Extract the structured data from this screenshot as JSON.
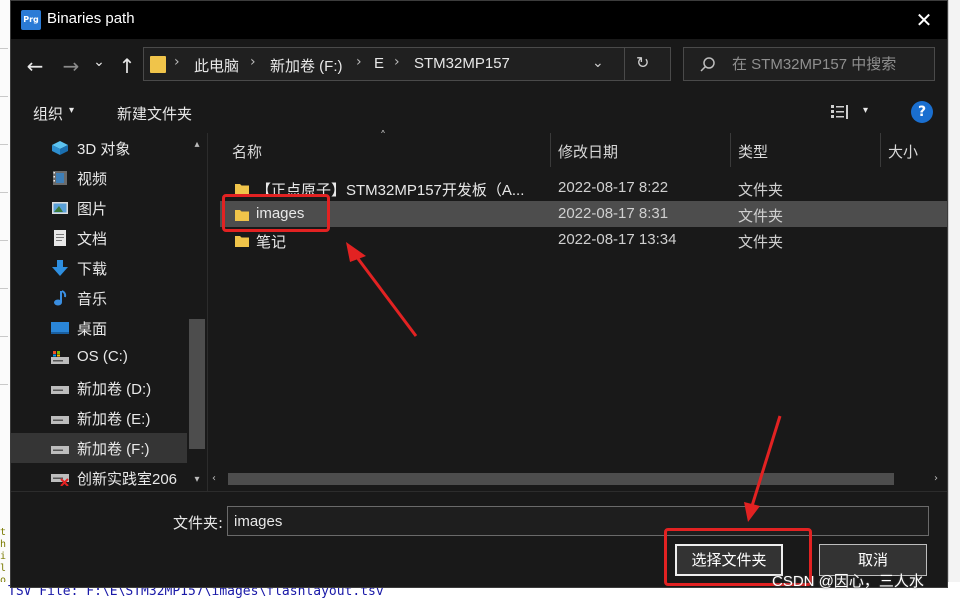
{
  "window": {
    "title": "Binaries path",
    "app_icon_text": "Prg",
    "close_glyph": "✕"
  },
  "nav": {
    "back_glyph": "←",
    "forward_glyph": "→",
    "recent_glyph": "⌄",
    "up_glyph": "↑",
    "breadcrumbs": [
      "此电脑",
      "新加卷 (F:)",
      "E",
      "STM32MP157"
    ],
    "separator": "›",
    "dropdown_glyph": "⌄",
    "refresh_glyph": "↻"
  },
  "search": {
    "placeholder": "在 STM32MP157 中搜索"
  },
  "toolbar": {
    "organize_label": "组织",
    "dropdown_glyph": "▾",
    "new_folder_label": "新建文件夹",
    "help_glyph": "?"
  },
  "sidebar": {
    "items": [
      {
        "label": "3D 对象",
        "icon": "3d-objects-icon"
      },
      {
        "label": "视频",
        "icon": "video-icon"
      },
      {
        "label": "图片",
        "icon": "pictures-icon"
      },
      {
        "label": "文档",
        "icon": "documents-icon"
      },
      {
        "label": "下载",
        "icon": "download-icon"
      },
      {
        "label": "音乐",
        "icon": "music-icon"
      },
      {
        "label": "桌面",
        "icon": "desktop-icon"
      },
      {
        "label": "OS (C:)",
        "icon": "drive-icon"
      },
      {
        "label": "新加卷 (D:)",
        "icon": "drive-icon"
      },
      {
        "label": "新加卷 (E:)",
        "icon": "drive-icon"
      },
      {
        "label": "新加卷 (F:)",
        "icon": "drive-icon"
      },
      {
        "label": "创新实践室206",
        "icon": "network-drive-icon"
      }
    ],
    "selected_index": 10,
    "scroll_up_glyph": "▴",
    "scroll_down_glyph": "▾"
  },
  "columns": {
    "name": "名称",
    "date": "修改日期",
    "type": "类型",
    "size": "大小",
    "sort_glyph": "˄"
  },
  "files": [
    {
      "name": "【正点原子】STM32MP157开发板（A...",
      "date": "2022-08-17 8:22",
      "type": "文件夹"
    },
    {
      "name": "images",
      "date": "2022-08-17 8:31",
      "type": "文件夹"
    },
    {
      "name": "笔记",
      "date": "2022-08-17 13:34",
      "type": "文件夹"
    }
  ],
  "selected_file_index": 1,
  "hscroll": {
    "left_glyph": "‹",
    "right_glyph": "›"
  },
  "footer": {
    "folder_label": "文件夹:",
    "folder_value": "images",
    "select_button": "选择文件夹",
    "cancel_button": "取消"
  },
  "background": {
    "bottom_text": "TSV File: F:\\E\\STM32MP157\\images\\flashlayout.tsv",
    "left_chars": [
      "t",
      "h",
      "i",
      "l",
      "o"
    ]
  },
  "watermark": "CSDN @因心，三人水",
  "colors": {
    "dialog_bg": "#191919",
    "titlebar_bg": "#000000",
    "selection": "#4d4d4d",
    "folder": "#f0c44a",
    "annotation": "#e22222",
    "accent": "#2b7bd6"
  }
}
